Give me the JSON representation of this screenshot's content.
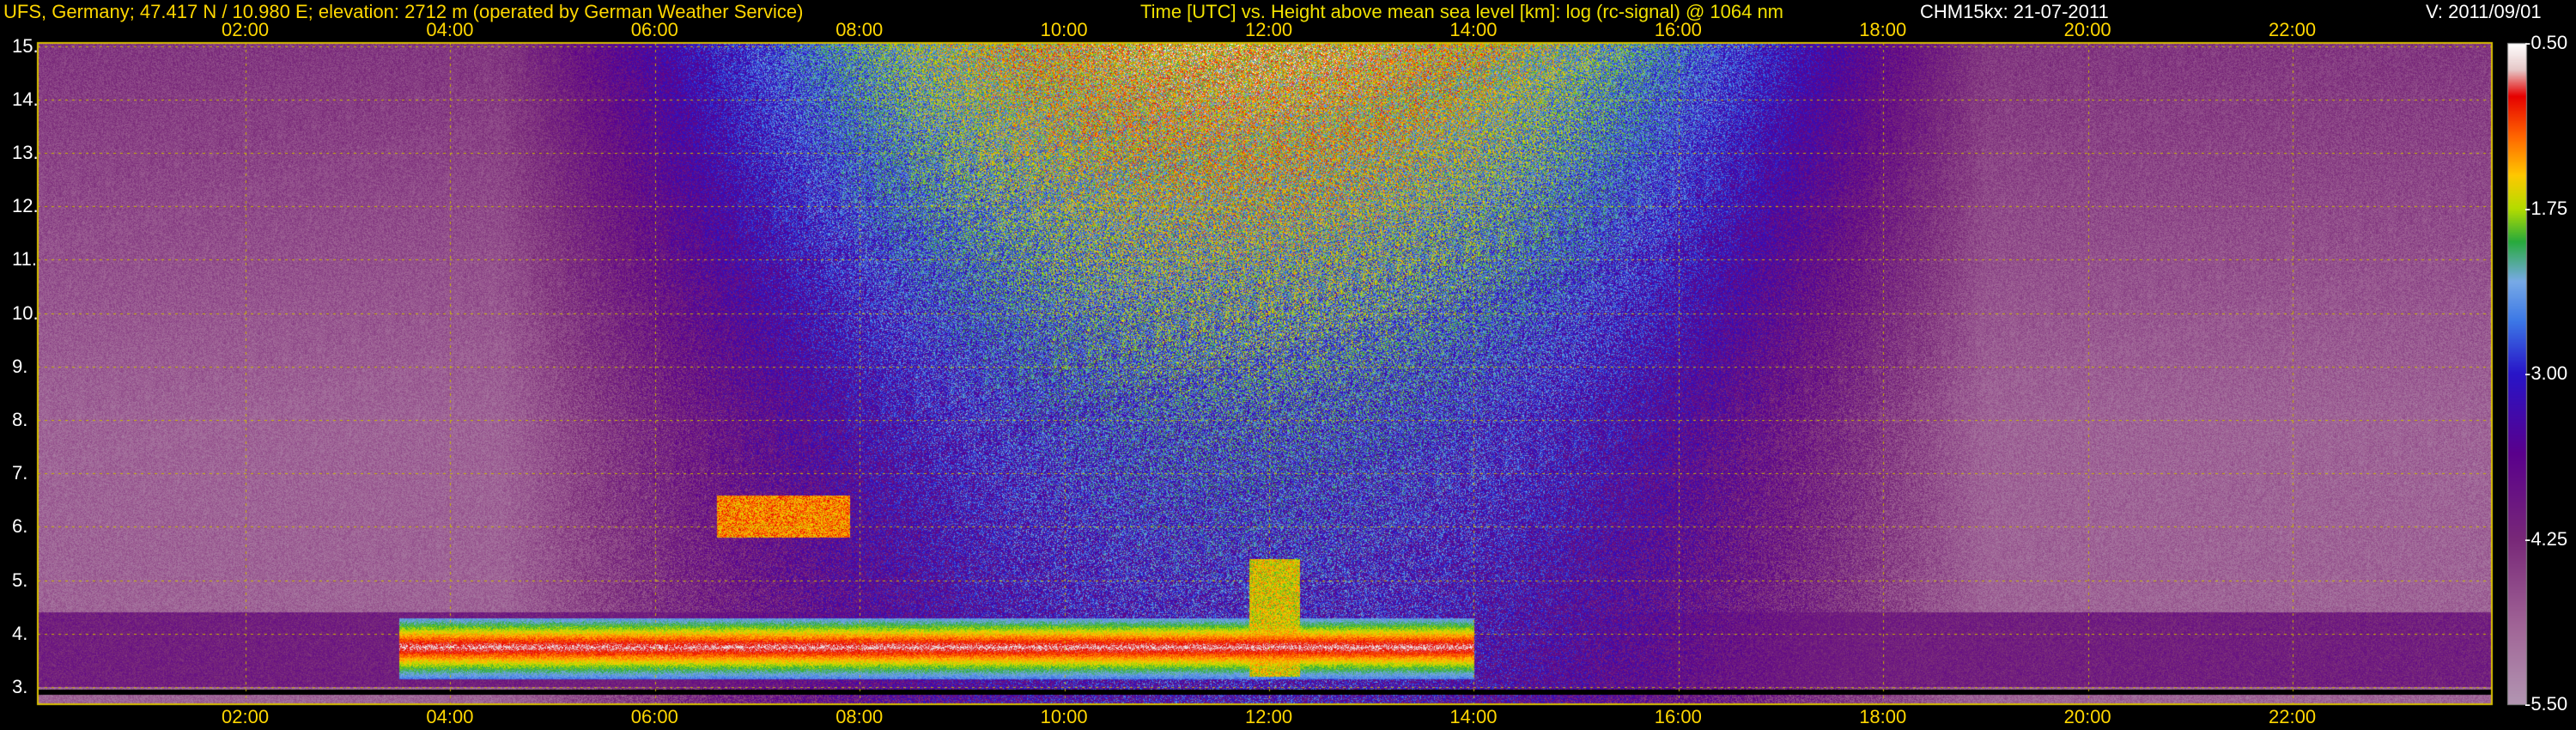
{
  "header": {
    "station": "UFS, Germany; 47.417 N / 10.980 E; elevation: 2712 m  (operated by German Weather Service)",
    "title": "Time [UTC] vs. Height above mean sea level [km]: log (rc-signal) @ 1064 nm",
    "instrument": "CHM15kx: 21-07-2011",
    "version": "V: 2011/09/01"
  },
  "colors": {
    "header_yellow": "#ffd700",
    "title_yellow": "#f0e000",
    "grid": "#c8b400",
    "tick_text": "#ffd700",
    "background": "#000000"
  },
  "chart_data": {
    "type": "heatmap",
    "title": "Time [UTC] vs. Height above mean sea level [km]: log (rc-signal) @ 1064 nm",
    "xlabel": "Time [UTC]",
    "ylabel": "Height above mean sea level [km]",
    "x_ticks": [
      "02:00",
      "04:00",
      "06:00",
      "08:00",
      "10:00",
      "12:00",
      "14:00",
      "16:00",
      "18:00",
      "20:00",
      "22:00"
    ],
    "x_tick_hours": [
      2,
      4,
      6,
      8,
      10,
      12,
      14,
      16,
      18,
      20,
      22
    ],
    "xlim": [
      0,
      24
    ],
    "y_ticks": [
      "3.",
      "4.",
      "5.",
      "6.",
      "7.",
      "8.",
      "9.",
      "10.",
      "11.",
      "12.",
      "13.",
      "14.",
      "15."
    ],
    "y_tick_values": [
      3,
      4,
      5,
      6,
      7,
      8,
      9,
      10,
      11,
      12,
      13,
      14,
      15
    ],
    "ylim": [
      2.71,
      15.7
    ],
    "colorbar": {
      "labels": [
        "-0.50",
        "-1.75",
        "-3.00",
        "-4.25",
        "-5.50"
      ],
      "range": [
        -5.5,
        -0.5
      ]
    },
    "grid": true,
    "features": [
      {
        "name": "boundary layer",
        "x_start": 3.5,
        "x_end": 14.0,
        "y_low": 3.0,
        "y_high": 4.3
      },
      {
        "name": "cloud",
        "x_start": 6.6,
        "x_end": 7.9,
        "y_low": 5.8,
        "y_high": 6.6
      },
      {
        "name": "convective plume",
        "x_start": 11.8,
        "x_end": 12.3,
        "y_low": 3.2,
        "y_high": 5.4
      }
    ]
  }
}
